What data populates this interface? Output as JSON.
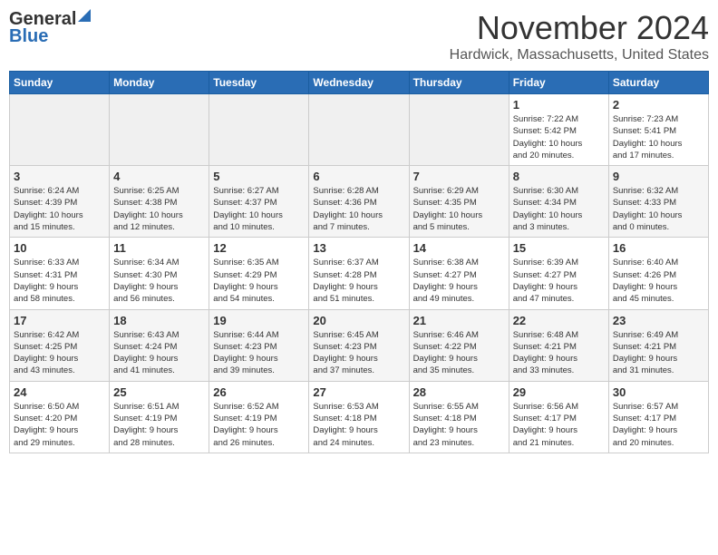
{
  "header": {
    "logo_general": "General",
    "logo_blue": "Blue",
    "month": "November 2024",
    "location": "Hardwick, Massachusetts, United States"
  },
  "weekdays": [
    "Sunday",
    "Monday",
    "Tuesday",
    "Wednesday",
    "Thursday",
    "Friday",
    "Saturday"
  ],
  "weeks": [
    [
      {
        "day": "",
        "info": ""
      },
      {
        "day": "",
        "info": ""
      },
      {
        "day": "",
        "info": ""
      },
      {
        "day": "",
        "info": ""
      },
      {
        "day": "",
        "info": ""
      },
      {
        "day": "1",
        "info": "Sunrise: 7:22 AM\nSunset: 5:42 PM\nDaylight: 10 hours\nand 20 minutes."
      },
      {
        "day": "2",
        "info": "Sunrise: 7:23 AM\nSunset: 5:41 PM\nDaylight: 10 hours\nand 17 minutes."
      }
    ],
    [
      {
        "day": "3",
        "info": "Sunrise: 6:24 AM\nSunset: 4:39 PM\nDaylight: 10 hours\nand 15 minutes."
      },
      {
        "day": "4",
        "info": "Sunrise: 6:25 AM\nSunset: 4:38 PM\nDaylight: 10 hours\nand 12 minutes."
      },
      {
        "day": "5",
        "info": "Sunrise: 6:27 AM\nSunset: 4:37 PM\nDaylight: 10 hours\nand 10 minutes."
      },
      {
        "day": "6",
        "info": "Sunrise: 6:28 AM\nSunset: 4:36 PM\nDaylight: 10 hours\nand 7 minutes."
      },
      {
        "day": "7",
        "info": "Sunrise: 6:29 AM\nSunset: 4:35 PM\nDaylight: 10 hours\nand 5 minutes."
      },
      {
        "day": "8",
        "info": "Sunrise: 6:30 AM\nSunset: 4:34 PM\nDaylight: 10 hours\nand 3 minutes."
      },
      {
        "day": "9",
        "info": "Sunrise: 6:32 AM\nSunset: 4:33 PM\nDaylight: 10 hours\nand 0 minutes."
      }
    ],
    [
      {
        "day": "10",
        "info": "Sunrise: 6:33 AM\nSunset: 4:31 PM\nDaylight: 9 hours\nand 58 minutes."
      },
      {
        "day": "11",
        "info": "Sunrise: 6:34 AM\nSunset: 4:30 PM\nDaylight: 9 hours\nand 56 minutes."
      },
      {
        "day": "12",
        "info": "Sunrise: 6:35 AM\nSunset: 4:29 PM\nDaylight: 9 hours\nand 54 minutes."
      },
      {
        "day": "13",
        "info": "Sunrise: 6:37 AM\nSunset: 4:28 PM\nDaylight: 9 hours\nand 51 minutes."
      },
      {
        "day": "14",
        "info": "Sunrise: 6:38 AM\nSunset: 4:27 PM\nDaylight: 9 hours\nand 49 minutes."
      },
      {
        "day": "15",
        "info": "Sunrise: 6:39 AM\nSunset: 4:27 PM\nDaylight: 9 hours\nand 47 minutes."
      },
      {
        "day": "16",
        "info": "Sunrise: 6:40 AM\nSunset: 4:26 PM\nDaylight: 9 hours\nand 45 minutes."
      }
    ],
    [
      {
        "day": "17",
        "info": "Sunrise: 6:42 AM\nSunset: 4:25 PM\nDaylight: 9 hours\nand 43 minutes."
      },
      {
        "day": "18",
        "info": "Sunrise: 6:43 AM\nSunset: 4:24 PM\nDaylight: 9 hours\nand 41 minutes."
      },
      {
        "day": "19",
        "info": "Sunrise: 6:44 AM\nSunset: 4:23 PM\nDaylight: 9 hours\nand 39 minutes."
      },
      {
        "day": "20",
        "info": "Sunrise: 6:45 AM\nSunset: 4:23 PM\nDaylight: 9 hours\nand 37 minutes."
      },
      {
        "day": "21",
        "info": "Sunrise: 6:46 AM\nSunset: 4:22 PM\nDaylight: 9 hours\nand 35 minutes."
      },
      {
        "day": "22",
        "info": "Sunrise: 6:48 AM\nSunset: 4:21 PM\nDaylight: 9 hours\nand 33 minutes."
      },
      {
        "day": "23",
        "info": "Sunrise: 6:49 AM\nSunset: 4:21 PM\nDaylight: 9 hours\nand 31 minutes."
      }
    ],
    [
      {
        "day": "24",
        "info": "Sunrise: 6:50 AM\nSunset: 4:20 PM\nDaylight: 9 hours\nand 29 minutes."
      },
      {
        "day": "25",
        "info": "Sunrise: 6:51 AM\nSunset: 4:19 PM\nDaylight: 9 hours\nand 28 minutes."
      },
      {
        "day": "26",
        "info": "Sunrise: 6:52 AM\nSunset: 4:19 PM\nDaylight: 9 hours\nand 26 minutes."
      },
      {
        "day": "27",
        "info": "Sunrise: 6:53 AM\nSunset: 4:18 PM\nDaylight: 9 hours\nand 24 minutes."
      },
      {
        "day": "28",
        "info": "Sunrise: 6:55 AM\nSunset: 4:18 PM\nDaylight: 9 hours\nand 23 minutes."
      },
      {
        "day": "29",
        "info": "Sunrise: 6:56 AM\nSunset: 4:17 PM\nDaylight: 9 hours\nand 21 minutes."
      },
      {
        "day": "30",
        "info": "Sunrise: 6:57 AM\nSunset: 4:17 PM\nDaylight: 9 hours\nand 20 minutes."
      }
    ]
  ]
}
